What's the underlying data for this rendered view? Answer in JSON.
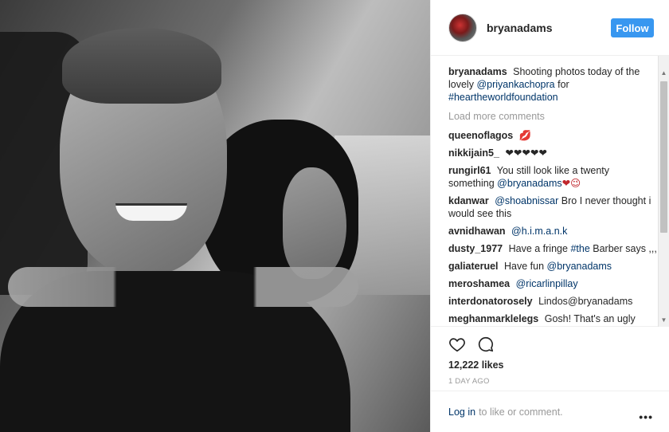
{
  "header": {
    "username": "bryanadams",
    "follow_label": "Follow"
  },
  "caption": {
    "user": "bryanadams",
    "text1": "Shooting photos today of the lovely",
    "mention": "@priyankachopra",
    "text2": "for",
    "hashtag": "#heartheworldfoundation"
  },
  "load_more": "Load more comments",
  "comments": [
    {
      "user": "queenoflagos",
      "text": "💋"
    },
    {
      "user": "nikkijain5_",
      "text": "❤❤❤❤❤"
    },
    {
      "user": "rungirl61",
      "text": "You still look like a twenty something",
      "mention": "@bryanadams",
      "suffix": "❤😉"
    },
    {
      "user": "kdanwar",
      "mention": "@shoabnissar",
      "text": "Bro I never thought i would see this"
    },
    {
      "user": "avnidhawan",
      "mention": "@h.i.m.a.n.k"
    },
    {
      "user": "dusty_1977",
      "text": "Have a fringe",
      "hashtag": "#the",
      "text2": "Barber says ,,,"
    },
    {
      "user": "galiateruel",
      "text": "Have fun",
      "mention": "@bryanadams"
    },
    {
      "user": "meroshamea",
      "mention": "@ricarlinpillay"
    },
    {
      "user": "interdonatorosely",
      "text": "Lindos@bryanadams"
    },
    {
      "user": "meghanmarklelegs",
      "text": "Gosh! That's an ugly"
    }
  ],
  "likes": "12,222 likes",
  "timestamp": "1 DAY AGO",
  "login": {
    "link": "Log in",
    "text": "to like or comment."
  },
  "more_options": "•••",
  "colors": {
    "follow_bg": "#3897f0",
    "link": "#003569",
    "muted": "#999999"
  }
}
